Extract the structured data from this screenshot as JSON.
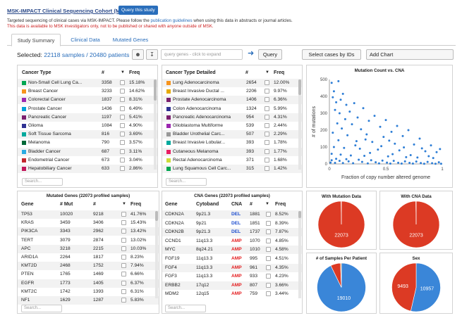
{
  "header": {
    "study_title": "MSK-IMPACT Clinical Sequencing Cohort (MSKCC)",
    "query_study_label": "Query this study",
    "description_pre": "Targeted sequencing of clinical cases via MSK-IMPACT. Please follow the ",
    "description_link": "publication guidelines",
    "description_post": " when using this data in abstracts or journal articles.",
    "warning": "This data is available to MSK investigators only, not to be published or shared with anyone outside of MSK."
  },
  "tabs": [
    {
      "label": "Study Summary",
      "active": true
    },
    {
      "label": "Clinical Data",
      "active": false
    },
    {
      "label": "Mutated Genes",
      "active": false
    }
  ],
  "toolbar": {
    "selected_label": "Selected: ",
    "samples": "22118 samples",
    "sep": " / ",
    "patients": "20480 patients",
    "user_icon": "user-icon",
    "download_icon": "download-icon",
    "gene_placeholder": "query genes - click to expand",
    "query_label": "Query",
    "select_cases_label": "Select cases by IDs",
    "add_chart_label": "Add Chart"
  },
  "cancer_type": {
    "headers": [
      "Cancer Type",
      "#",
      "Freq"
    ],
    "rows": [
      {
        "name": "Non-Small Cell Lung Ca...",
        "n": "3358",
        "freq": "15.18%",
        "color": "#00a651"
      },
      {
        "name": "Breast Cancer",
        "n": "3233",
        "freq": "14.62%",
        "color": "#f7941d"
      },
      {
        "name": "Colorectal Cancer",
        "n": "1837",
        "freq": "8.31%",
        "color": "#9b27b0"
      },
      {
        "name": "Prostate Cancer",
        "n": "1436",
        "freq": "6.49%",
        "color": "#00a2d8"
      },
      {
        "name": "Pancreatic Cancer",
        "n": "1197",
        "freq": "5.41%",
        "color": "#7b1f6e"
      },
      {
        "name": "Glioma",
        "n": "1084",
        "freq": "4.90%",
        "color": "#2e3192"
      },
      {
        "name": "Soft Tissue Sarcoma",
        "n": "816",
        "freq": "3.69%",
        "color": "#00a99d"
      },
      {
        "name": "Melanoma",
        "n": "790",
        "freq": "3.57%",
        "color": "#006837"
      },
      {
        "name": "Bladder Cancer",
        "n": "687",
        "freq": "3.11%",
        "color": "#29abe2"
      },
      {
        "name": "Endometrial Cancer",
        "n": "673",
        "freq": "3.04%",
        "color": "#c1272d"
      },
      {
        "name": "Hepatobiliary Cancer",
        "n": "633",
        "freq": "2.86%",
        "color": "#c2185b"
      }
    ],
    "search": "Search..."
  },
  "cancer_type_detailed": {
    "headers": [
      "Cancer Type Detailed",
      "#",
      "Freq"
    ],
    "rows": [
      {
        "name": "Lung Adenocarcinoma",
        "n": "2654",
        "freq": "12.00%",
        "color": "#f7941d"
      },
      {
        "name": "Breast Invasive Ductal ...",
        "n": "2206",
        "freq": "9.97%",
        "color": "#e6aa00"
      },
      {
        "name": "Prostate Adenocarcinoma",
        "n": "1406",
        "freq": "6.36%",
        "color": "#7b1f6e"
      },
      {
        "name": "Colon Adenocarcinoma",
        "n": "1324",
        "freq": "5.99%",
        "color": "#2e3192"
      },
      {
        "name": "Pancreatic Adenocarcinoma",
        "n": "954",
        "freq": "4.31%",
        "color": "#7b1f6e"
      },
      {
        "name": "Glioblastoma Multiforme",
        "n": "539",
        "freq": "2.44%",
        "color": "#9b27b0"
      },
      {
        "name": "Bladder Urothelial Carc...",
        "n": "507",
        "freq": "2.29%",
        "color": "#999999"
      },
      {
        "name": "Breast Invasive Lobular...",
        "n": "393",
        "freq": "1.78%",
        "color": "#00a99d"
      },
      {
        "name": "Cutaneous Melanoma",
        "n": "393",
        "freq": "1.77%",
        "color": "#e91e63"
      },
      {
        "name": "Rectal Adenocarcinoma",
        "n": "371",
        "freq": "1.68%",
        "color": "#cddc39"
      },
      {
        "name": "Lung Squamous Cell Carc...",
        "n": "315",
        "freq": "1.42%",
        "color": "#00a651"
      }
    ],
    "search": "Search..."
  },
  "mutated_genes": {
    "title": "Mutated Genes (22073 profiled samples)",
    "headers": [
      "Gene",
      "# Mut",
      "#",
      "Freq"
    ],
    "rows": [
      {
        "gene": "TP53",
        "mut": "10020",
        "n": "9218",
        "freq": "41.76%"
      },
      {
        "gene": "KRAS",
        "mut": "3459",
        "n": "3406",
        "freq": "15.43%"
      },
      {
        "gene": "PIK3CA",
        "mut": "3343",
        "n": "2962",
        "freq": "13.42%"
      },
      {
        "gene": "TERT",
        "mut": "3079",
        "n": "2874",
        "freq": "13.02%"
      },
      {
        "gene": "APC",
        "mut": "3218",
        "n": "2215",
        "freq": "10.03%"
      },
      {
        "gene": "ARID1A",
        "mut": "2264",
        "n": "1817",
        "freq": "8.23%"
      },
      {
        "gene": "KMT2D",
        "mut": "2468",
        "n": "1752",
        "freq": "7.94%"
      },
      {
        "gene": "PTEN",
        "mut": "1765",
        "n": "1469",
        "freq": "6.66%"
      },
      {
        "gene": "EGFR",
        "mut": "1773",
        "n": "1405",
        "freq": "6.37%"
      },
      {
        "gene": "KMT2C",
        "mut": "1742",
        "n": "1393",
        "freq": "6.31%"
      },
      {
        "gene": "NF1",
        "mut": "1629",
        "n": "1287",
        "freq": "5.83%"
      }
    ],
    "search": "Search..."
  },
  "cna_genes": {
    "title": "CNA Genes (22073 profiled samples)",
    "headers": [
      "Gene",
      "Cytoband",
      "CNA",
      "#",
      "Freq"
    ],
    "rows": [
      {
        "gene": "CDKN2A",
        "cyto": "9p21.3",
        "cna": "DEL",
        "n": "1881",
        "freq": "8.52%"
      },
      {
        "gene": "CDKN2A",
        "cyto": "9p21",
        "cna": "DEL",
        "n": "1851",
        "freq": "8.39%"
      },
      {
        "gene": "CDKN2B",
        "cyto": "9p21.3",
        "cna": "DEL",
        "n": "1737",
        "freq": "7.87%"
      },
      {
        "gene": "CCND1",
        "cyto": "11q13.3",
        "cna": "AMP",
        "n": "1070",
        "freq": "4.85%"
      },
      {
        "gene": "MYC",
        "cyto": "8q24.21",
        "cna": "AMP",
        "n": "1010",
        "freq": "4.58%"
      },
      {
        "gene": "FGF19",
        "cyto": "11q13.3",
        "cna": "AMP",
        "n": "995",
        "freq": "4.51%"
      },
      {
        "gene": "FGF4",
        "cyto": "11q13.3",
        "cna": "AMP",
        "n": "961",
        "freq": "4.35%"
      },
      {
        "gene": "FGF3",
        "cyto": "11q13.3",
        "cna": "AMP",
        "n": "933",
        "freq": "4.23%"
      },
      {
        "gene": "ERBB2",
        "cyto": "17q12",
        "cna": "AMP",
        "n": "807",
        "freq": "3.66%"
      },
      {
        "gene": "MDM2",
        "cyto": "12q15",
        "cna": "AMP",
        "n": "759",
        "freq": "3.44%"
      }
    ],
    "search": "Search..."
  },
  "colors": {
    "amp": "#e41a1c",
    "del": "#1f4fcf",
    "pie_red": "#dc3a24",
    "pie_blue": "#3a86d8",
    "scatter": "#2e7ed6"
  },
  "chart_data": [
    {
      "type": "scatter",
      "title": "Mutation Count vs. CNA",
      "xlabel": "Fraction of copy number altered genome",
      "ylabel": "# of mutations",
      "xlim": [
        0,
        1
      ],
      "ylim": [
        0,
        500
      ],
      "xticks": [
        "0",
        "0.5",
        "1"
      ],
      "yticks": [
        "0",
        "100",
        "200",
        "300",
        "400",
        "500"
      ],
      "points": [
        [
          0.02,
          480
        ],
        [
          0.04,
          430
        ],
        [
          0.08,
          490
        ],
        [
          0.12,
          415
        ],
        [
          0.03,
          395
        ],
        [
          0.06,
          365
        ],
        [
          0.1,
          380
        ],
        [
          0.15,
          350
        ],
        [
          0.22,
          360
        ],
        [
          0.05,
          320
        ],
        [
          0.18,
          310
        ],
        [
          0.3,
          330
        ],
        [
          0.09,
          300
        ],
        [
          0.25,
          275
        ],
        [
          0.4,
          285
        ],
        [
          0.14,
          265
        ],
        [
          0.35,
          255
        ],
        [
          0.5,
          260
        ],
        [
          0.07,
          240
        ],
        [
          0.2,
          235
        ],
        [
          0.45,
          220
        ],
        [
          0.6,
          225
        ],
        [
          0.11,
          210
        ],
        [
          0.28,
          205
        ],
        [
          0.55,
          190
        ],
        [
          0.7,
          200
        ],
        [
          0.03,
          185
        ],
        [
          0.16,
          170
        ],
        [
          0.33,
          175
        ],
        [
          0.48,
          160
        ],
        [
          0.65,
          165
        ],
        [
          0.8,
          150
        ],
        [
          0.08,
          140
        ],
        [
          0.24,
          135
        ],
        [
          0.38,
          130
        ],
        [
          0.58,
          120
        ],
        [
          0.75,
          115
        ],
        [
          0.9,
          110
        ],
        [
          0.04,
          100
        ],
        [
          0.13,
          95
        ],
        [
          0.27,
          90
        ],
        [
          0.43,
          85
        ],
        [
          0.62,
          80
        ],
        [
          0.85,
          75
        ],
        [
          0.95,
          70
        ],
        [
          0.02,
          60
        ],
        [
          0.1,
          55
        ],
        [
          0.19,
          50
        ],
        [
          0.31,
          48
        ],
        [
          0.52,
          45
        ],
        [
          0.68,
          40
        ],
        [
          0.78,
          38
        ],
        [
          0.92,
          35
        ],
        [
          0.06,
          30
        ],
        [
          0.15,
          28
        ],
        [
          0.26,
          25
        ],
        [
          0.37,
          22
        ],
        [
          0.47,
          20
        ],
        [
          0.57,
          18
        ],
        [
          0.67,
          15
        ],
        [
          0.77,
          14
        ],
        [
          0.87,
          12
        ],
        [
          0.97,
          10
        ],
        [
          0.01,
          8
        ],
        [
          0.05,
          6
        ],
        [
          0.12,
          5
        ],
        [
          0.21,
          4
        ],
        [
          0.34,
          3
        ],
        [
          0.44,
          3
        ],
        [
          0.54,
          2
        ],
        [
          0.64,
          2
        ],
        [
          0.74,
          2
        ],
        [
          0.84,
          1
        ],
        [
          0.94,
          1
        ],
        [
          0.99,
          1
        ],
        [
          0.02,
          22
        ],
        [
          0.09,
          18
        ],
        [
          0.17,
          15
        ],
        [
          0.29,
          12
        ],
        [
          0.41,
          10
        ],
        [
          0.51,
          8
        ],
        [
          0.61,
          7
        ],
        [
          0.71,
          6
        ],
        [
          0.81,
          5
        ],
        [
          0.91,
          4
        ],
        [
          0.36,
          65
        ],
        [
          0.56,
          58
        ],
        [
          0.72,
          52
        ],
        [
          0.88,
          46
        ],
        [
          0.23,
          110
        ],
        [
          0.46,
          105
        ],
        [
          0.66,
          98
        ],
        [
          0.82,
          92
        ],
        [
          0.98,
          88
        ],
        [
          0.32,
          145
        ],
        [
          0.53,
          138
        ]
      ]
    },
    {
      "type": "pie",
      "title": "With Mutation Data",
      "slices": [
        {
          "label": "22073",
          "value": 22073,
          "color": "#dc3a24"
        },
        {
          "label": "",
          "value": 45,
          "color": "#e98b7f"
        }
      ]
    },
    {
      "type": "pie",
      "title": "With CNA Data",
      "slices": [
        {
          "label": "22073",
          "value": 22073,
          "color": "#dc3a24"
        },
        {
          "label": "",
          "value": 45,
          "color": "#e98b7f"
        }
      ]
    },
    {
      "type": "pie",
      "title": "# of Samples Per Patient",
      "slices": [
        {
          "label": "19010",
          "value": 19010,
          "color": "#3a86d8"
        },
        {
          "label": "",
          "value": 1350,
          "color": "#dc3a24"
        },
        {
          "label": "",
          "value": 120,
          "color": "#f2a23a"
        }
      ]
    },
    {
      "type": "pie",
      "title": "Sex",
      "slices": [
        {
          "label": "10957",
          "value": 10957,
          "color": "#3a86d8"
        },
        {
          "label": "9493",
          "value": 9493,
          "color": "#dc3a24"
        }
      ]
    }
  ]
}
